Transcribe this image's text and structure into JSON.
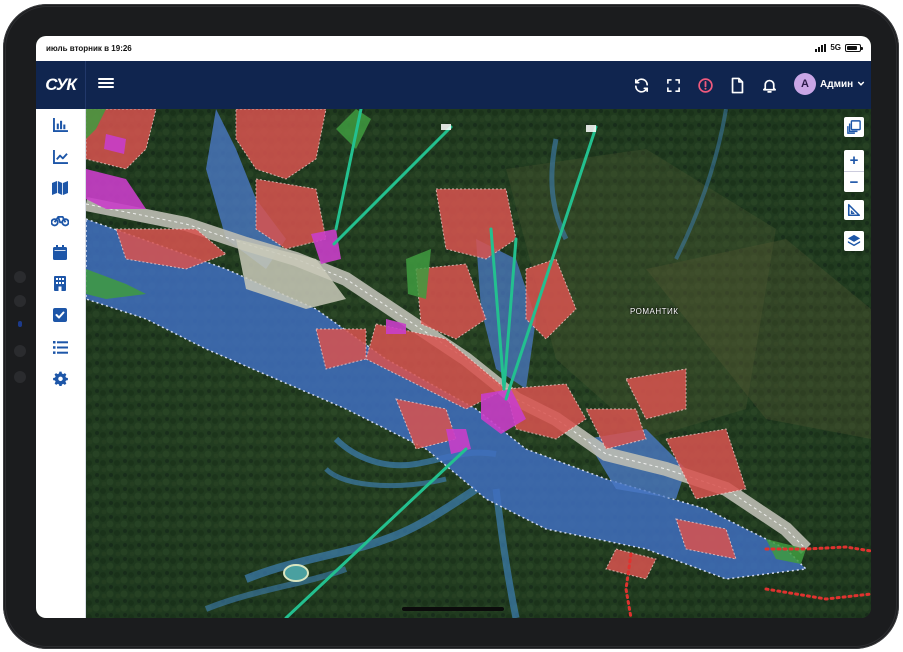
{
  "status_bar": {
    "time": "июль вторник в 19:26",
    "network": "5G"
  },
  "app": {
    "logo_text": "СУК",
    "brand_color": "#10254f",
    "accent_color": "#1d56a8"
  },
  "topbar": {
    "icons": [
      "refresh-icon",
      "fullscreen-icon",
      "alert-icon",
      "document-icon",
      "bell-icon"
    ],
    "user": {
      "initial": "A",
      "name": "Админ"
    }
  },
  "sidebar": {
    "items": [
      {
        "icon": "bar-chart-icon"
      },
      {
        "icon": "line-chart-icon"
      },
      {
        "icon": "map-icon"
      },
      {
        "icon": "bicycle-icon"
      },
      {
        "icon": "calendar-icon"
      },
      {
        "icon": "building-icon"
      },
      {
        "icon": "checkbox-icon"
      },
      {
        "icon": "list-icon"
      },
      {
        "icon": "settings-gear-icon"
      }
    ]
  },
  "map": {
    "place_label": "РОМАНТИК",
    "controls": {
      "zoom_in": "+",
      "zoom_out": "−"
    }
  }
}
